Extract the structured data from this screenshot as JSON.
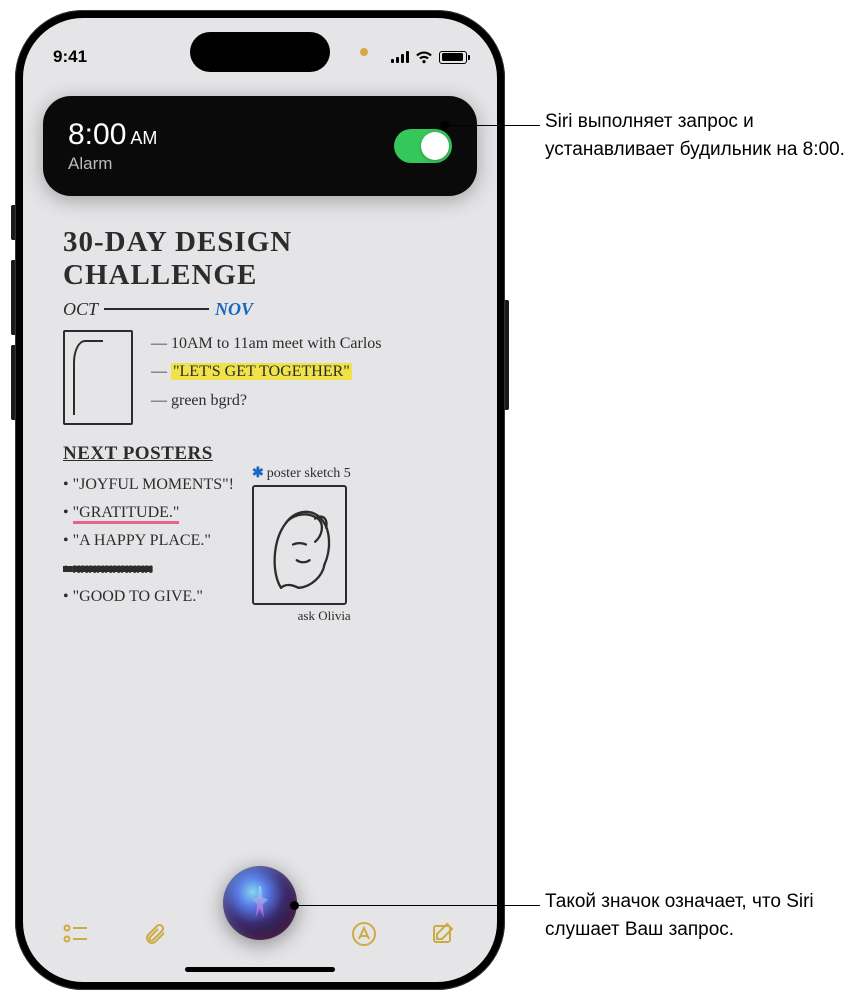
{
  "status": {
    "time": "9:41"
  },
  "alarm": {
    "time": "8:00",
    "ampm": "AM",
    "label": "Alarm",
    "toggle_on": true
  },
  "note": {
    "title_line1": "30-DAY DESIGN",
    "title_line2": "CHALLENGE",
    "month_start": "OCT",
    "month_end": "NOV",
    "bullets": [
      "10AM to 11am meet with Carlos",
      "\"LET'S GET TOGETHER\"",
      "green bgrd?"
    ],
    "next_header": "NEXT POSTERS",
    "posters": [
      "\"JOYFUL MOMENTS\"!",
      "\"GRATITUDE.\"",
      "\"A HAPPY PLACE.\"",
      "xxxxxxxxxx",
      "\"GOOD TO GIVE.\""
    ],
    "sketch_label": "poster sketch 5",
    "ask": "ask Olivia"
  },
  "callouts": {
    "top": "Siri выполняет запрос и устанавливает будильник на 8:00.",
    "bottom": "Такой значок означает, что Siri слушает Ваш запрос."
  }
}
